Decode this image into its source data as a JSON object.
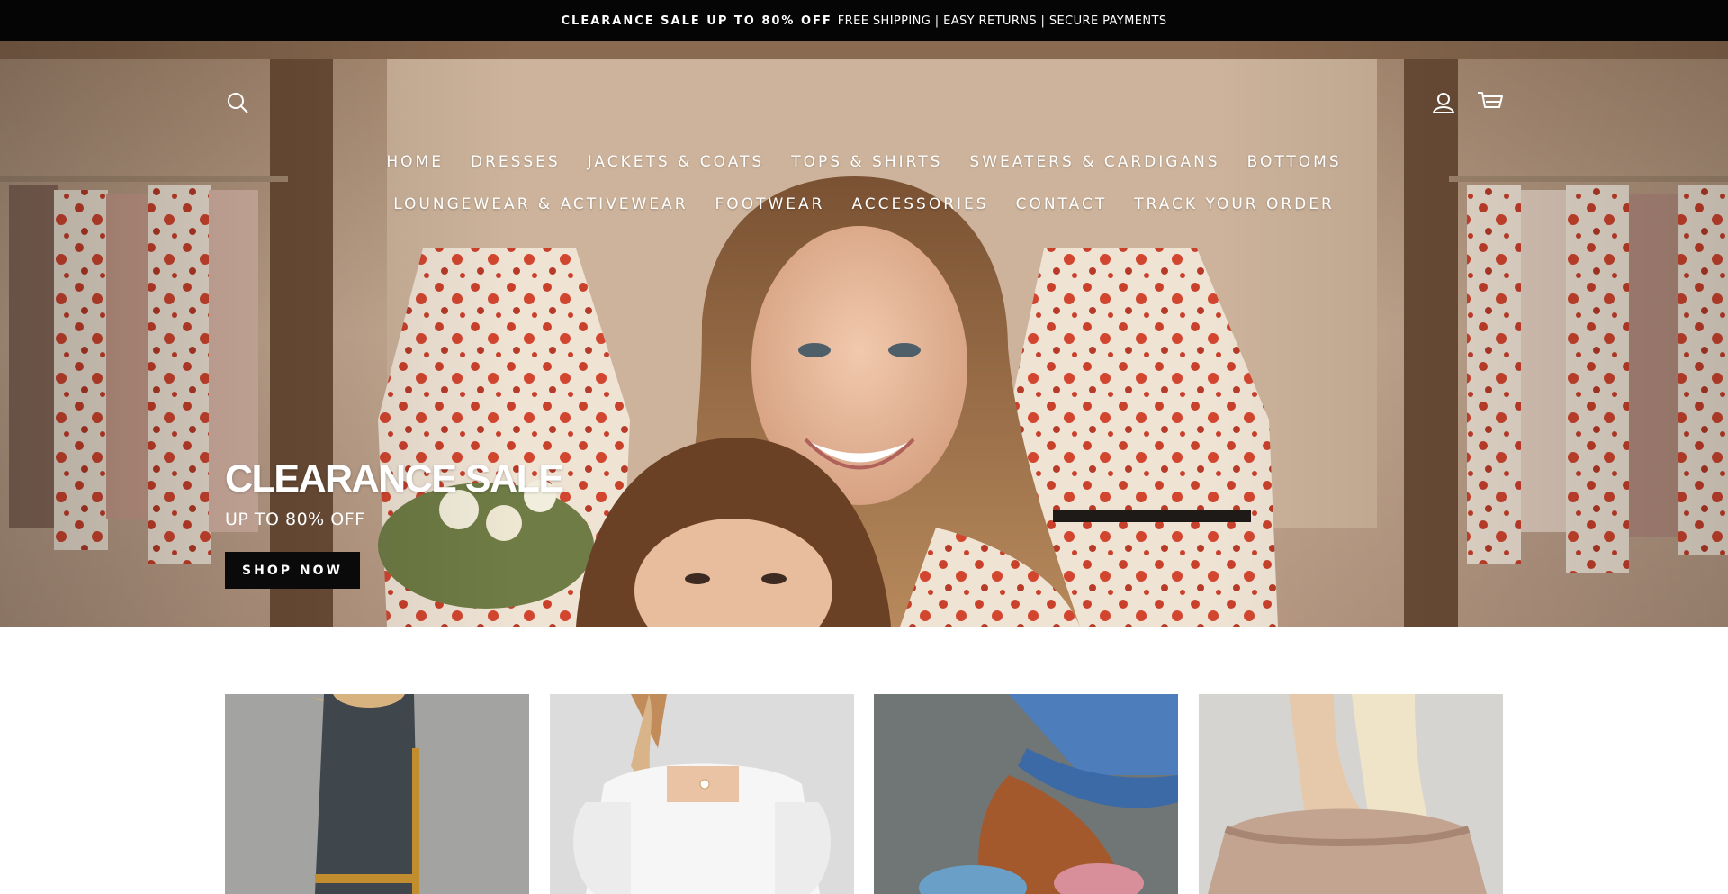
{
  "announcement": {
    "highlight": "CLEARANCE SALE UP TO 80% OFF",
    "text": "FREE SHIPPING | EASY RETURNS | SECURE PAYMENTS"
  },
  "header": {
    "icons": [
      "search-icon",
      "account-icon",
      "cart-icon"
    ]
  },
  "nav": {
    "row1": [
      "HOME",
      "DRESSES",
      "JACKETS & COATS",
      "TOPS & SHIRTS",
      "SWEATERS & CARDIGANS",
      "BOTTOMS"
    ],
    "row2": [
      "LOUNGEWEAR & ACTIVEWEAR",
      "FOOTWEAR",
      "ACCESSORIES",
      "CONTACT",
      "TRACK YOUR ORDER"
    ]
  },
  "hero": {
    "title": "CLEARANCE SALE",
    "subtitle": "UP TO 80% OFF",
    "button": "SHOP NOW"
  },
  "colors": {
    "announcement_bg": "#050505",
    "button_bg": "#0a0a0a",
    "text_light": "#ffffff"
  }
}
